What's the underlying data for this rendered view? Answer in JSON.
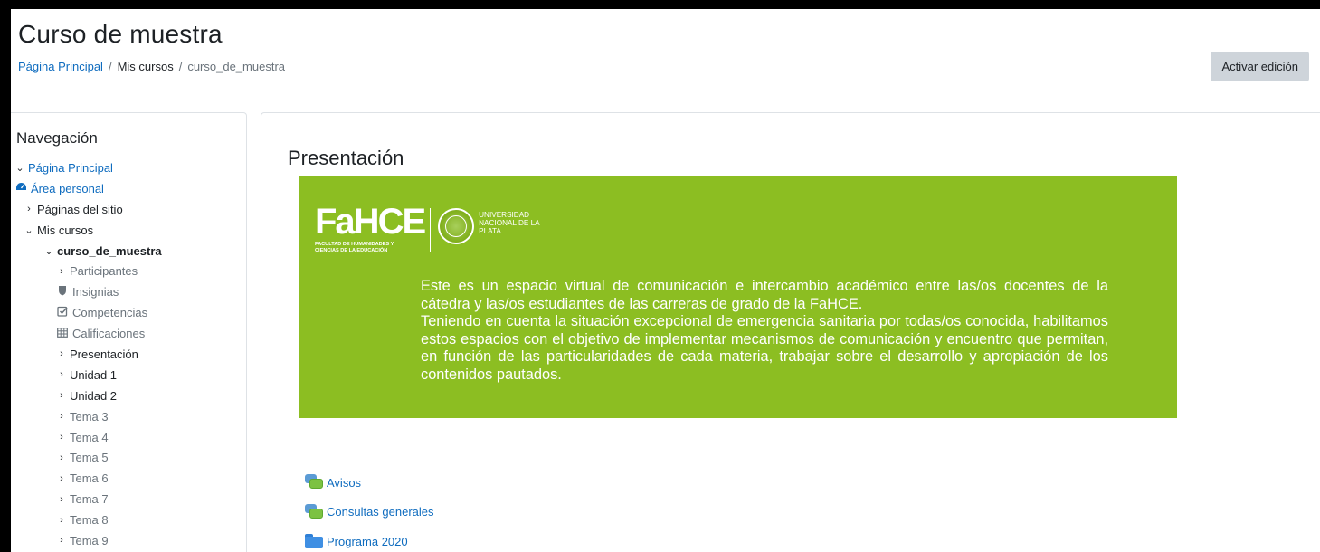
{
  "header": {
    "title": "Curso de muestra",
    "breadcrumb": [
      "Página Principal",
      "Mis cursos",
      "curso_de_muestra"
    ],
    "edit_button": "Activar edición"
  },
  "nav": {
    "title": "Navegación",
    "items": [
      {
        "label": "Página Principal",
        "chevron": "down",
        "icon": null
      },
      {
        "label": "Área personal",
        "chevron": null,
        "icon": "dashboard-icon"
      },
      {
        "label": "Páginas del sitio",
        "chevron": "right",
        "icon": null
      },
      {
        "label": "Mis cursos",
        "chevron": "down",
        "icon": null
      },
      {
        "label": "curso_de_muestra",
        "chevron": "down",
        "icon": null
      },
      {
        "label": "Participantes",
        "chevron": "right",
        "icon": null
      },
      {
        "label": "Insignias",
        "chevron": null,
        "icon": "shield-icon"
      },
      {
        "label": "Competencias",
        "chevron": null,
        "icon": "checkbox-icon"
      },
      {
        "label": "Calificaciones",
        "chevron": null,
        "icon": "table-icon"
      },
      {
        "label": "Presentación",
        "chevron": "right",
        "icon": null
      },
      {
        "label": "Unidad 1",
        "chevron": "right",
        "icon": null
      },
      {
        "label": "Unidad 2",
        "chevron": "right",
        "icon": null
      },
      {
        "label": "Tema 3",
        "chevron": "right",
        "icon": null
      },
      {
        "label": "Tema 4",
        "chevron": "right",
        "icon": null
      },
      {
        "label": "Tema 5",
        "chevron": "right",
        "icon": null
      },
      {
        "label": "Tema 6",
        "chevron": "right",
        "icon": null
      },
      {
        "label": "Tema 7",
        "chevron": "right",
        "icon": null
      },
      {
        "label": "Tema 8",
        "chevron": "right",
        "icon": null
      },
      {
        "label": "Tema 9",
        "chevron": "right",
        "icon": null
      }
    ]
  },
  "section": {
    "title": "Presentación",
    "banner": {
      "logo_text": "FaHCE",
      "logo_subtitle": "FACULTAD DE HUMANIDADES Y CIENCIAS DE LA EDUCACIÓN",
      "university": "UNIVERSIDAD NACIONAL DE LA PLATA",
      "paragraph_1": "Este es un espacio virtual de comunicación e intercambio académico entre las/os docentes de la cátedra y las/os estudiantes de las carreras de grado de la FaHCE.",
      "paragraph_2": "Teniendo en cuenta la situación excepcional de emergencia sanitaria por todas/os conocida, habilitamos estos espacios con el objetivo de implementar mecanismos de comunicación y encuentro que permitan, en función de las particularidades de cada materia, trabajar sobre el desarrollo y apropiación de los contenidos pautados.",
      "color": "#8cbe22"
    },
    "activities": [
      {
        "label": "Avisos",
        "icon": "forum-icon"
      },
      {
        "label": "Consultas generales",
        "icon": "forum-icon"
      },
      {
        "label": "Programa 2020",
        "icon": "folder-icon"
      }
    ]
  },
  "colors": {
    "link": "#0f6cbf",
    "button_bg": "#ced4da",
    "muted": "#6a737b"
  }
}
